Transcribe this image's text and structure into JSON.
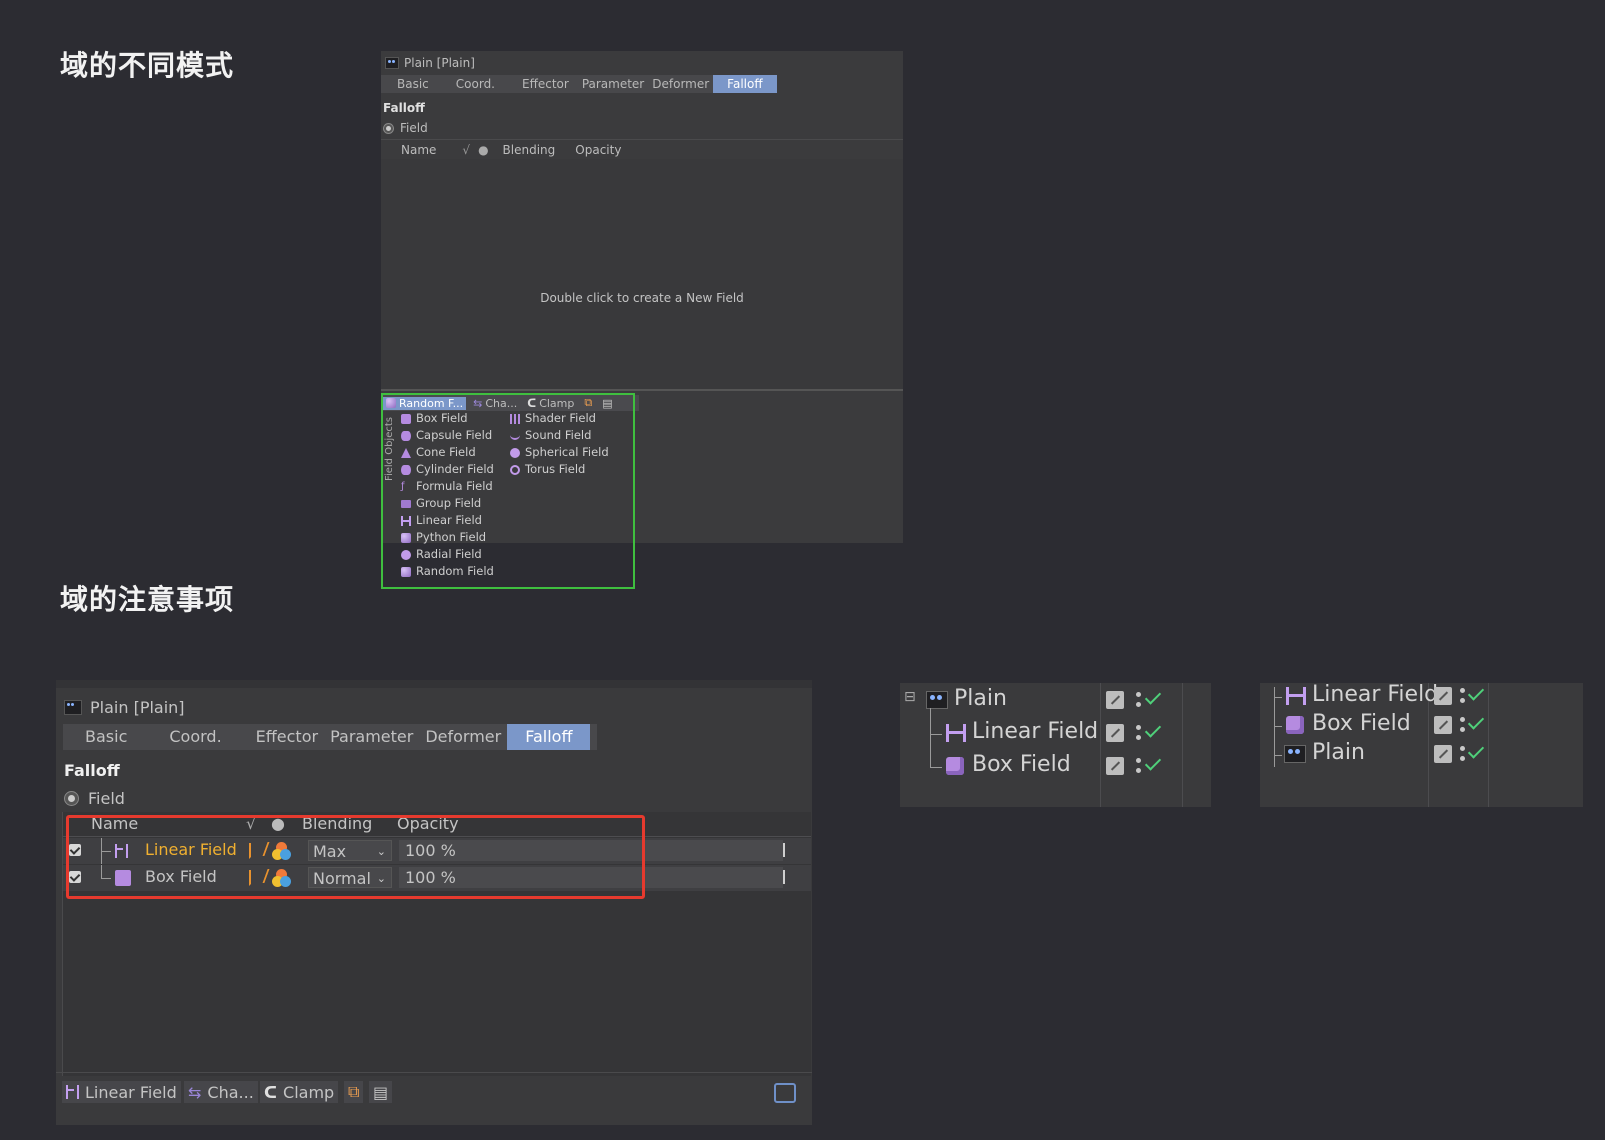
{
  "headings": {
    "modes": "域的不同模式",
    "notes": "域的注意事项"
  },
  "panel_top": {
    "title": "Plain [Plain]",
    "tabs": [
      "Basic",
      "Coord.",
      "Effector",
      "Parameter",
      "Deformer",
      "Falloff"
    ],
    "active_tab": "Falloff",
    "section": "Falloff",
    "field_label": "Field",
    "columns": {
      "name": "Name",
      "blending": "Blending",
      "opacity": "Opacity"
    },
    "empty_hint": "Double click to create a New Field",
    "toolbar": {
      "random": "Random F...",
      "channel": "Cha...",
      "clamp": "Clamp"
    },
    "menu_vertical_label": "Field Objects",
    "menu_left": [
      "Box Field",
      "Capsule Field",
      "Cone Field",
      "Cylinder Field",
      "Formula Field",
      "Group Field",
      "Linear Field",
      "Python Field",
      "Radial Field",
      "Random Field"
    ],
    "menu_right": [
      "Shader Field",
      "Sound Field",
      "Spherical Field",
      "Torus Field"
    ]
  },
  "panel_bottom": {
    "title": "Plain [Plain]",
    "tabs": [
      "Basic",
      "Coord.",
      "Effector",
      "Parameter",
      "Deformer",
      "Falloff"
    ],
    "active_tab": "Falloff",
    "section": "Falloff",
    "field_label": "Field",
    "columns": {
      "name": "Name",
      "blending": "Blending",
      "opacity": "Opacity"
    },
    "rows": [
      {
        "name": "Linear Field",
        "blending": "Max",
        "opacity": "100 %",
        "highlight_color": "#f0b030"
      },
      {
        "name": "Box Field",
        "blending": "Normal",
        "opacity": "100 %"
      }
    ],
    "bottombar": {
      "linear": "Linear Field",
      "channel": "Cha...",
      "clamp": "Clamp"
    }
  },
  "tree_left": {
    "items": [
      "Plain",
      "Linear Field",
      "Box Field"
    ]
  },
  "tree_right": {
    "items": [
      "Linear Field",
      "Box Field",
      "Plain"
    ]
  },
  "colors": {
    "background": "#2c2c32",
    "active_tab": "#7b97c9",
    "menu_outline": "#3fbf3f",
    "highlight_outline": "#e63a2e",
    "check": "#4fd07a"
  }
}
